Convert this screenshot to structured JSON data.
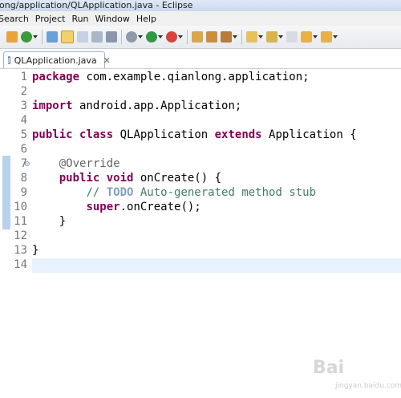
{
  "window": {
    "title": "long/application/QLApplication.java - Eclipse"
  },
  "menu": [
    "Search",
    "Project",
    "Run",
    "Window",
    "Help"
  ],
  "tab": {
    "label": "QLApplication.java",
    "close": "✕"
  },
  "gutter": [
    "1",
    "2",
    "3",
    "4",
    "5",
    "6",
    "7",
    "8",
    "9",
    "10",
    "11",
    "12",
    "13",
    "14"
  ],
  "code": {
    "l1_kw": "package",
    "l1_rest": " com.example.qianlong.application;",
    "l3_kw": "import",
    "l3_rest": " android.app.Application;",
    "l5_kw1": "public",
    "l5_kw2": "class",
    "l5_name": " QLApplication ",
    "l5_kw3": "extends",
    "l5_rest": " Application {",
    "l7_ann": "@Override",
    "l8_kw1": "public",
    "l8_kw2": "void",
    "l8_rest": " onCreate() {",
    "l9_slash": "// ",
    "l9_todo": "TODO",
    "l9_rest": " Auto-generated method stub",
    "l10_kw": "super",
    "l10_rest": ".onCreate();",
    "l11": "}",
    "l13": "}"
  },
  "watermark": {
    "main": "Bai",
    "sub": "jingyan.baidu.com"
  },
  "colors": {
    "keyword": "#7f0055",
    "comment": "#3f7f5f",
    "todo": "#7f9fbf",
    "annotation": "#646464"
  }
}
